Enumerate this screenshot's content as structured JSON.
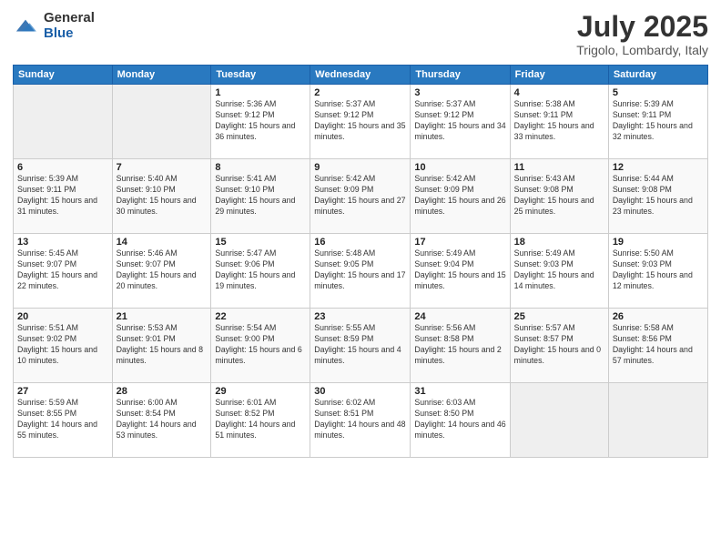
{
  "logo": {
    "general": "General",
    "blue": "Blue"
  },
  "calendar": {
    "title": "July 2025",
    "subtitle": "Trigolo, Lombardy, Italy"
  },
  "weekdays": [
    "Sunday",
    "Monday",
    "Tuesday",
    "Wednesday",
    "Thursday",
    "Friday",
    "Saturday"
  ],
  "weeks": [
    [
      {
        "day": "",
        "empty": true
      },
      {
        "day": "",
        "empty": true
      },
      {
        "day": "1",
        "sunrise": "Sunrise: 5:36 AM",
        "sunset": "Sunset: 9:12 PM",
        "daylight": "Daylight: 15 hours and 36 minutes."
      },
      {
        "day": "2",
        "sunrise": "Sunrise: 5:37 AM",
        "sunset": "Sunset: 9:12 PM",
        "daylight": "Daylight: 15 hours and 35 minutes."
      },
      {
        "day": "3",
        "sunrise": "Sunrise: 5:37 AM",
        "sunset": "Sunset: 9:12 PM",
        "daylight": "Daylight: 15 hours and 34 minutes."
      },
      {
        "day": "4",
        "sunrise": "Sunrise: 5:38 AM",
        "sunset": "Sunset: 9:11 PM",
        "daylight": "Daylight: 15 hours and 33 minutes."
      },
      {
        "day": "5",
        "sunrise": "Sunrise: 5:39 AM",
        "sunset": "Sunset: 9:11 PM",
        "daylight": "Daylight: 15 hours and 32 minutes."
      }
    ],
    [
      {
        "day": "6",
        "sunrise": "Sunrise: 5:39 AM",
        "sunset": "Sunset: 9:11 PM",
        "daylight": "Daylight: 15 hours and 31 minutes."
      },
      {
        "day": "7",
        "sunrise": "Sunrise: 5:40 AM",
        "sunset": "Sunset: 9:10 PM",
        "daylight": "Daylight: 15 hours and 30 minutes."
      },
      {
        "day": "8",
        "sunrise": "Sunrise: 5:41 AM",
        "sunset": "Sunset: 9:10 PM",
        "daylight": "Daylight: 15 hours and 29 minutes."
      },
      {
        "day": "9",
        "sunrise": "Sunrise: 5:42 AM",
        "sunset": "Sunset: 9:09 PM",
        "daylight": "Daylight: 15 hours and 27 minutes."
      },
      {
        "day": "10",
        "sunrise": "Sunrise: 5:42 AM",
        "sunset": "Sunset: 9:09 PM",
        "daylight": "Daylight: 15 hours and 26 minutes."
      },
      {
        "day": "11",
        "sunrise": "Sunrise: 5:43 AM",
        "sunset": "Sunset: 9:08 PM",
        "daylight": "Daylight: 15 hours and 25 minutes."
      },
      {
        "day": "12",
        "sunrise": "Sunrise: 5:44 AM",
        "sunset": "Sunset: 9:08 PM",
        "daylight": "Daylight: 15 hours and 23 minutes."
      }
    ],
    [
      {
        "day": "13",
        "sunrise": "Sunrise: 5:45 AM",
        "sunset": "Sunset: 9:07 PM",
        "daylight": "Daylight: 15 hours and 22 minutes."
      },
      {
        "day": "14",
        "sunrise": "Sunrise: 5:46 AM",
        "sunset": "Sunset: 9:07 PM",
        "daylight": "Daylight: 15 hours and 20 minutes."
      },
      {
        "day": "15",
        "sunrise": "Sunrise: 5:47 AM",
        "sunset": "Sunset: 9:06 PM",
        "daylight": "Daylight: 15 hours and 19 minutes."
      },
      {
        "day": "16",
        "sunrise": "Sunrise: 5:48 AM",
        "sunset": "Sunset: 9:05 PM",
        "daylight": "Daylight: 15 hours and 17 minutes."
      },
      {
        "day": "17",
        "sunrise": "Sunrise: 5:49 AM",
        "sunset": "Sunset: 9:04 PM",
        "daylight": "Daylight: 15 hours and 15 minutes."
      },
      {
        "day": "18",
        "sunrise": "Sunrise: 5:49 AM",
        "sunset": "Sunset: 9:03 PM",
        "daylight": "Daylight: 15 hours and 14 minutes."
      },
      {
        "day": "19",
        "sunrise": "Sunrise: 5:50 AM",
        "sunset": "Sunset: 9:03 PM",
        "daylight": "Daylight: 15 hours and 12 minutes."
      }
    ],
    [
      {
        "day": "20",
        "sunrise": "Sunrise: 5:51 AM",
        "sunset": "Sunset: 9:02 PM",
        "daylight": "Daylight: 15 hours and 10 minutes."
      },
      {
        "day": "21",
        "sunrise": "Sunrise: 5:53 AM",
        "sunset": "Sunset: 9:01 PM",
        "daylight": "Daylight: 15 hours and 8 minutes."
      },
      {
        "day": "22",
        "sunrise": "Sunrise: 5:54 AM",
        "sunset": "Sunset: 9:00 PM",
        "daylight": "Daylight: 15 hours and 6 minutes."
      },
      {
        "day": "23",
        "sunrise": "Sunrise: 5:55 AM",
        "sunset": "Sunset: 8:59 PM",
        "daylight": "Daylight: 15 hours and 4 minutes."
      },
      {
        "day": "24",
        "sunrise": "Sunrise: 5:56 AM",
        "sunset": "Sunset: 8:58 PM",
        "daylight": "Daylight: 15 hours and 2 minutes."
      },
      {
        "day": "25",
        "sunrise": "Sunrise: 5:57 AM",
        "sunset": "Sunset: 8:57 PM",
        "daylight": "Daylight: 15 hours and 0 minutes."
      },
      {
        "day": "26",
        "sunrise": "Sunrise: 5:58 AM",
        "sunset": "Sunset: 8:56 PM",
        "daylight": "Daylight: 14 hours and 57 minutes."
      }
    ],
    [
      {
        "day": "27",
        "sunrise": "Sunrise: 5:59 AM",
        "sunset": "Sunset: 8:55 PM",
        "daylight": "Daylight: 14 hours and 55 minutes."
      },
      {
        "day": "28",
        "sunrise": "Sunrise: 6:00 AM",
        "sunset": "Sunset: 8:54 PM",
        "daylight": "Daylight: 14 hours and 53 minutes."
      },
      {
        "day": "29",
        "sunrise": "Sunrise: 6:01 AM",
        "sunset": "Sunset: 8:52 PM",
        "daylight": "Daylight: 14 hours and 51 minutes."
      },
      {
        "day": "30",
        "sunrise": "Sunrise: 6:02 AM",
        "sunset": "Sunset: 8:51 PM",
        "daylight": "Daylight: 14 hours and 48 minutes."
      },
      {
        "day": "31",
        "sunrise": "Sunrise: 6:03 AM",
        "sunset": "Sunset: 8:50 PM",
        "daylight": "Daylight: 14 hours and 46 minutes."
      },
      {
        "day": "",
        "empty": true
      },
      {
        "day": "",
        "empty": true
      }
    ]
  ]
}
